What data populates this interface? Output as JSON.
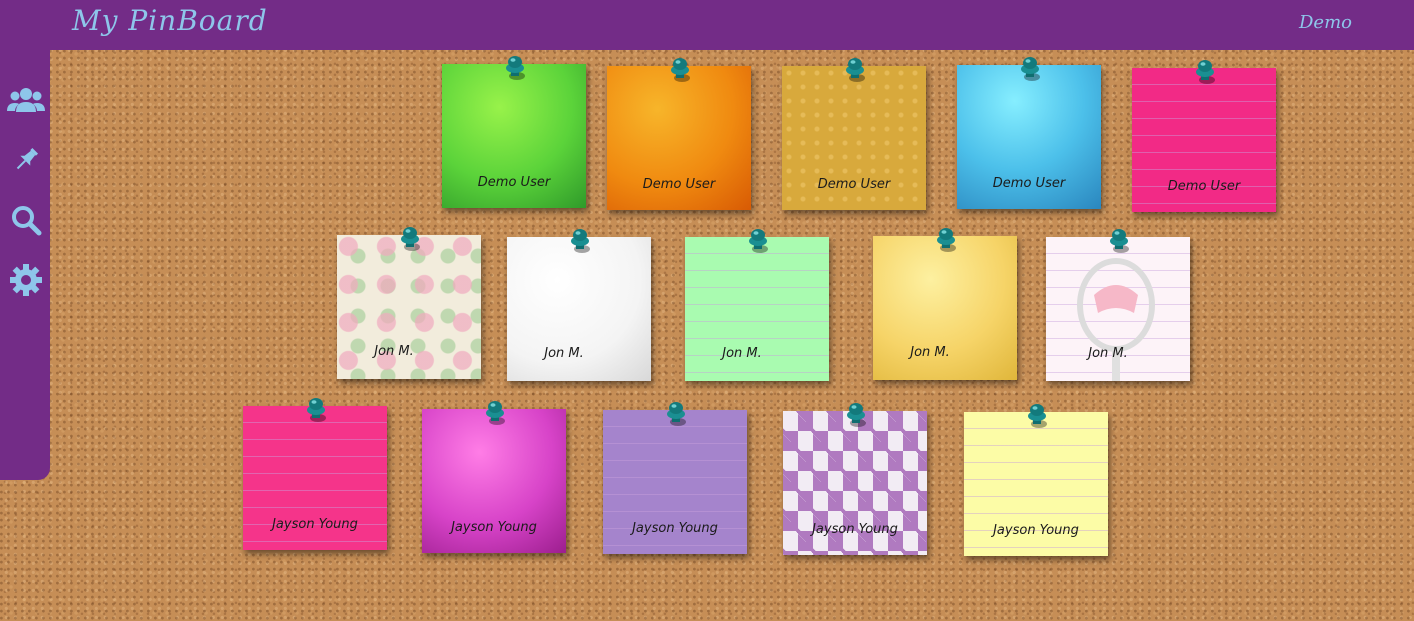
{
  "app": {
    "title": "My PinBoard",
    "user": "Demo"
  },
  "sidebar": {
    "items": [
      {
        "icon": "users-icon"
      },
      {
        "icon": "pin-icon"
      },
      {
        "icon": "search-icon"
      },
      {
        "icon": "gear-icon"
      }
    ]
  },
  "colors": {
    "brand": "#732c87",
    "accent": "#8ec6ea",
    "pin": "#137a7c"
  },
  "notes": {
    "row1": [
      "Demo User",
      "Demo User",
      "Demo User",
      "Demo User",
      "Demo User"
    ],
    "row2": [
      "Jon M.",
      "Jon M.",
      "Jon M.",
      "Jon M.",
      "Jon M."
    ],
    "row3": [
      "Jayson Young",
      "Jayson Young",
      "Jayson Young",
      "Jayson Young",
      "Jayson Young"
    ]
  }
}
